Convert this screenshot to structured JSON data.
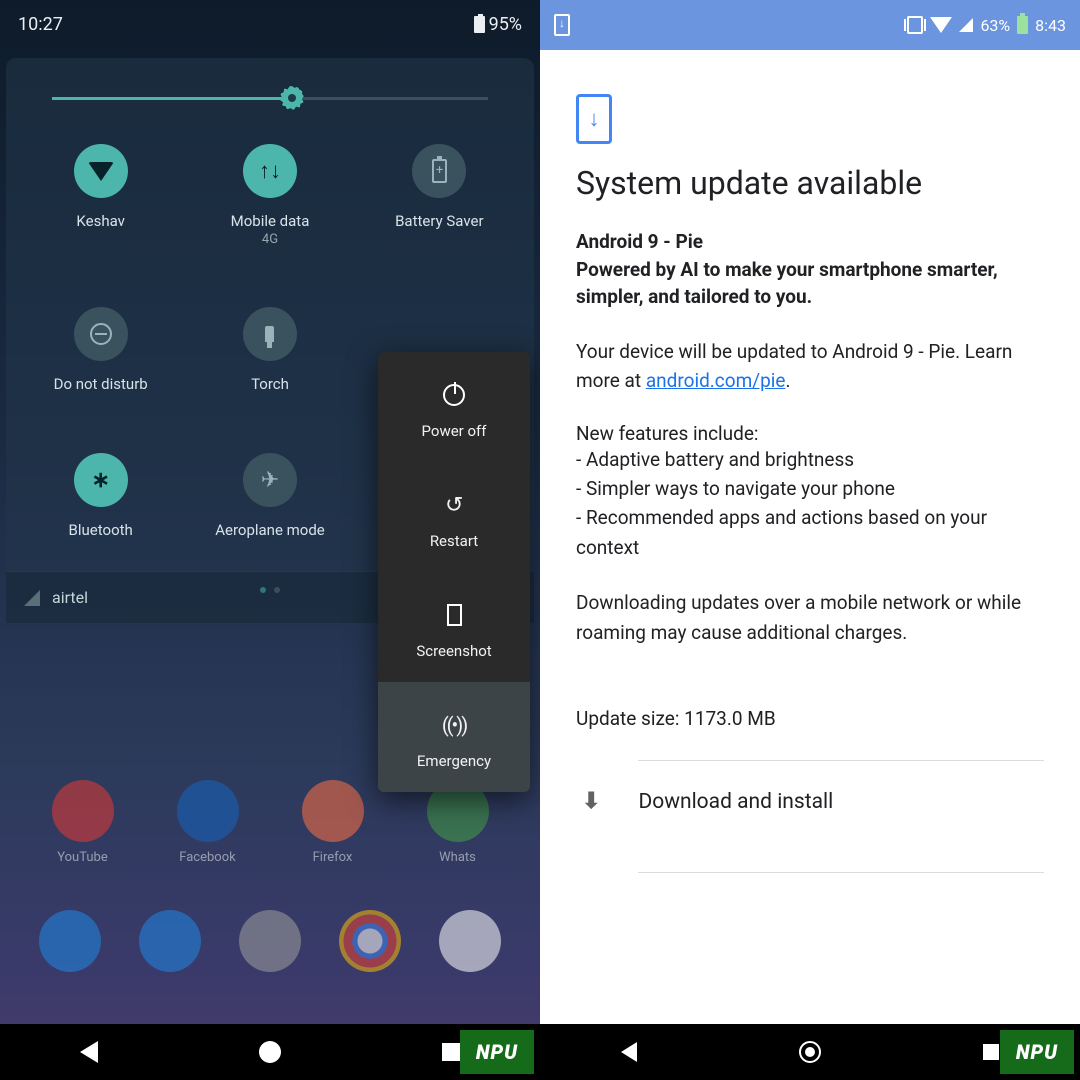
{
  "left": {
    "statusbar": {
      "time": "10:27",
      "battery_pct": "95%"
    },
    "brightness": {
      "fill_pct": 55
    },
    "tiles": [
      {
        "id": "wifi",
        "label": "Keshav",
        "sub": "",
        "on": true,
        "icon": "wifi-icon"
      },
      {
        "id": "data",
        "label": "Mobile data",
        "sub": "4G",
        "on": true,
        "icon": "mobile-data-icon"
      },
      {
        "id": "battsaver",
        "label": "Battery Saver",
        "sub": "",
        "on": false,
        "icon": "battery-plus-icon"
      },
      {
        "id": "dnd",
        "label": "Do not disturb",
        "sub": "",
        "on": false,
        "icon": "dnd-icon"
      },
      {
        "id": "torch",
        "label": "Torch",
        "sub": "",
        "on": false,
        "icon": "torch-icon"
      },
      {
        "id": "hidden",
        "label": "",
        "sub": "",
        "on": true,
        "icon": ""
      },
      {
        "id": "bluetooth",
        "label": "Bluetooth",
        "sub": "",
        "on": true,
        "icon": "bluetooth-icon"
      },
      {
        "id": "airplane",
        "label": "Aeroplane mode",
        "sub": "",
        "on": false,
        "icon": "airplane-icon"
      }
    ],
    "carrier": "airtel",
    "power_menu": [
      {
        "id": "poweroff",
        "label": "Power off",
        "icon": "power-icon"
      },
      {
        "id": "restart",
        "label": "Restart",
        "icon": "restart-icon"
      },
      {
        "id": "screenshot",
        "label": "Screenshot",
        "icon": "screenshot-icon"
      },
      {
        "id": "emergency",
        "label": "Emergency",
        "icon": "emergency-icon"
      }
    ],
    "apps_row1": [
      "YouTube",
      "Facebook",
      "Firefox",
      "Whats"
    ],
    "app_row1_colors": [
      "#e53935",
      "#1565c0",
      "#ff7043",
      "#43a047"
    ],
    "apps_row2_colors": [
      "#1e88e5",
      "#1e88e5",
      "#9e9e9e",
      "#ffffff",
      "#ffffff"
    ]
  },
  "right": {
    "statusbar": {
      "battery_pct": "63%",
      "time": "8:43"
    },
    "title": "System update available",
    "subtitle_top": "Android 9 - Pie",
    "subtitle": "Powered by AI to make your smartphone smarter, simpler, and tailored to you.",
    "body1_pre": "Your device will be updated to Android 9 - Pie. Learn more at ",
    "learn_link_text": "android.com/pie",
    "body1_post": ".",
    "features_title": "New features include:",
    "features": [
      "- Adaptive battery and brightness",
      "- Simpler ways to navigate your phone",
      "- Recommended apps and actions based on your context"
    ],
    "warning": "Downloading updates over a mobile network or while roaming may cause additional charges.",
    "size_label": "Update size: 1173.0 MB",
    "download_label": "Download and install"
  },
  "badge": "NPU"
}
